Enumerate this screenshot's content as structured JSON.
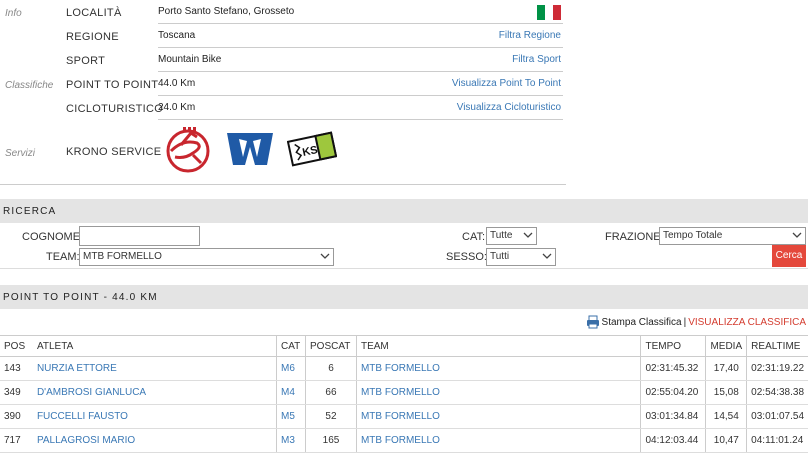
{
  "info": {
    "section_info": "Info",
    "section_classifiche": "Classifiche",
    "section_servizi": "Servizi",
    "localita_label": "LOCALITÀ",
    "localita_value": "Porto Santo Stefano, Grosseto",
    "regione_label": "REGIONE",
    "regione_value": "Toscana",
    "regione_action": "Filtra Regione",
    "sport_label": "SPORT",
    "sport_value": "Mountain Bike",
    "sport_action": "Filtra Sport",
    "ptp_label": "POINT TO POINT",
    "ptp_value": "44.0 Km",
    "ptp_action": "Visualizza Point To Point",
    "ciclo_label": "CICLOTURISTICO",
    "ciclo_value": "24.0 Km",
    "ciclo_action": "Visualizza Cicloturistico",
    "krono_label": "KRONO SERVICE",
    "flag_colors": [
      "#009246",
      "#ffffff",
      "#ce2b37"
    ],
    "logo_ks_text": "KS"
  },
  "ricerca": {
    "title": "RICERCA",
    "cognome_label": "COGNOME:",
    "cognome_value": "",
    "team_label": "TEAM:",
    "team_value": "MTB FORMELLO",
    "cat_label": "CAT:",
    "cat_value": "Tutte",
    "sesso_label": "SESSO:",
    "sesso_value": "Tutti",
    "frazione_label": "FRAZIONE:",
    "frazione_value": "Tempo Totale",
    "cerca_label": "Cerca"
  },
  "classifica": {
    "title": "POINT TO POINT - 44.0 KM",
    "stampa_label": "Stampa Classifica",
    "separator": "|",
    "visualizza_label": "VISUALIZZA CLASSIFICA",
    "headers": [
      "POS",
      "ATLETA",
      "CAT",
      "POSCAT",
      "TEAM",
      "TEMPO",
      "MEDIA",
      "REALTIME"
    ],
    "rows": [
      {
        "pos": "143",
        "atleta": "NURZIA ETTORE",
        "cat": "M6",
        "poscat": "6",
        "team": "MTB FORMELLO",
        "tempo": "02:31:45.32",
        "media": "17,40",
        "realtime": "02:31:19.22"
      },
      {
        "pos": "349",
        "atleta": "D'AMBROSI GIANLUCA",
        "cat": "M4",
        "poscat": "66",
        "team": "MTB FORMELLO",
        "tempo": "02:55:04.20",
        "media": "15,08",
        "realtime": "02:54:38.38"
      },
      {
        "pos": "390",
        "atleta": "FUCCELLI FAUSTO",
        "cat": "M5",
        "poscat": "52",
        "team": "MTB FORMELLO",
        "tempo": "03:01:34.84",
        "media": "14,54",
        "realtime": "03:01:07.54"
      },
      {
        "pos": "717",
        "atleta": "PALLAGROSI MARIO",
        "cat": "M3",
        "poscat": "165",
        "team": "MTB FORMELLO",
        "tempo": "04:12:03.44",
        "media": "10,47",
        "realtime": "04:11:01.24"
      }
    ]
  }
}
